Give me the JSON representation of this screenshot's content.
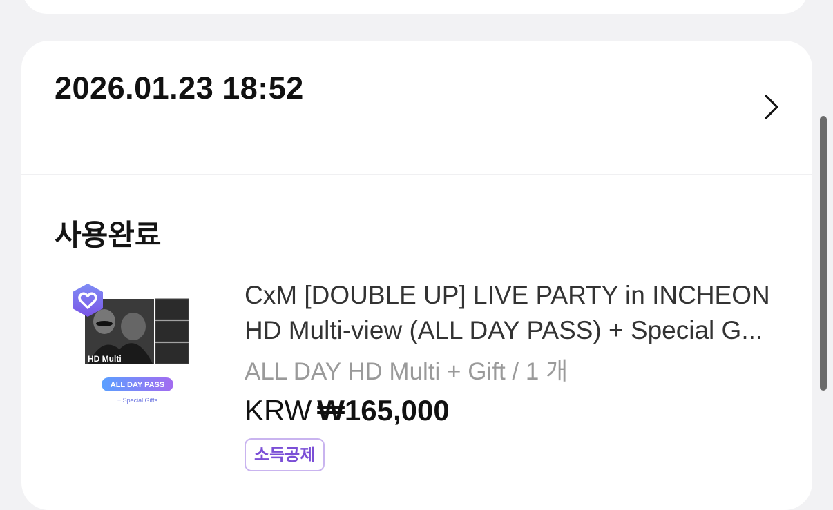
{
  "order": {
    "datetime": "2026.01.23 18:52",
    "status": "사용완료",
    "product": {
      "title_line1": "CxM [DOUBLE UP] LIVE PARTY in INCHEON",
      "title_line2": "HD Multi-view (ALL DAY PASS) + Special G...",
      "option": "ALL DAY HD Multi + Gift / 1 개",
      "currency": "KRW",
      "price": "₩165,000",
      "tag": "소득공제",
      "thumbnail": {
        "overlay_label": "HD Multi",
        "pass_label": "ALL DAY PASS",
        "gift_label": "+ Special Gifts"
      }
    }
  },
  "colors": {
    "background": "#f2f2f4",
    "card": "#ffffff",
    "tag_text": "#7b4fd6",
    "tag_border": "#c9b4ef",
    "badge": "#7b6cf0"
  }
}
